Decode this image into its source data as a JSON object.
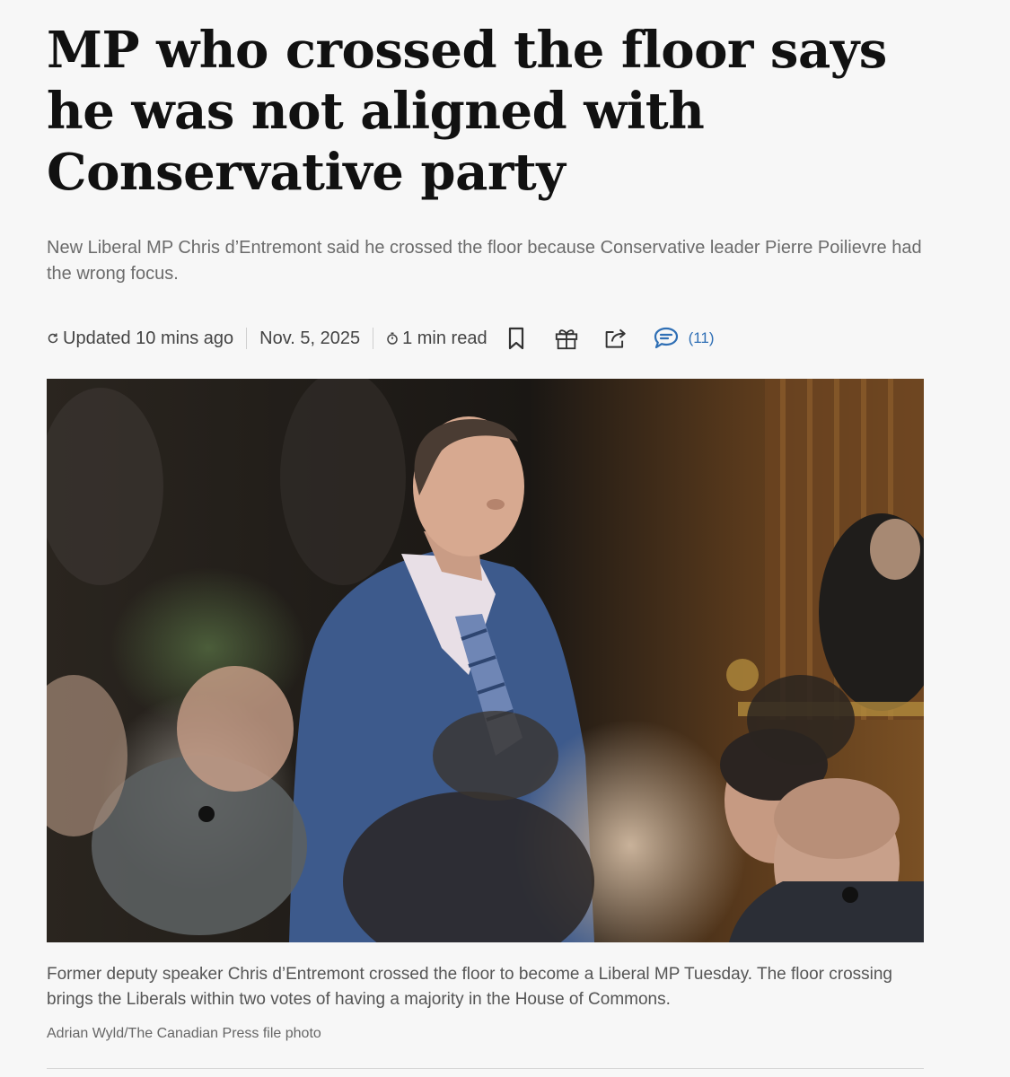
{
  "article": {
    "headline": "MP who crossed the floor says he was not aligned with Conservative party",
    "deck": "New Liberal MP Chris d’Entremont said he crossed the floor because Conservative leader Pierre Poilievre had the wrong focus.",
    "meta": {
      "updated": "Updated 10 mins ago",
      "date": "Nov. 5, 2025",
      "read_time": "1 min read",
      "comment_count": "(11)"
    },
    "icons": {
      "updated": "refresh-icon",
      "read_time": "stopwatch-icon",
      "bookmark": "bookmark-icon",
      "gift": "gift-icon",
      "share": "share-icon",
      "comments": "comment-icon"
    },
    "photo": {
      "caption": "Former deputy speaker Chris d’Entremont crossed the floor to become a Liberal MP Tuesday. The floor crossing brings the Liberals within two votes of having a majority in the House of Commons.",
      "credit": "Adrian Wyld/The Canadian Press file photo"
    }
  },
  "colors": {
    "background": "#f7f7f7",
    "headline": "#111111",
    "deck": "#6b6b6b",
    "link_accent": "#2f6fb5"
  }
}
